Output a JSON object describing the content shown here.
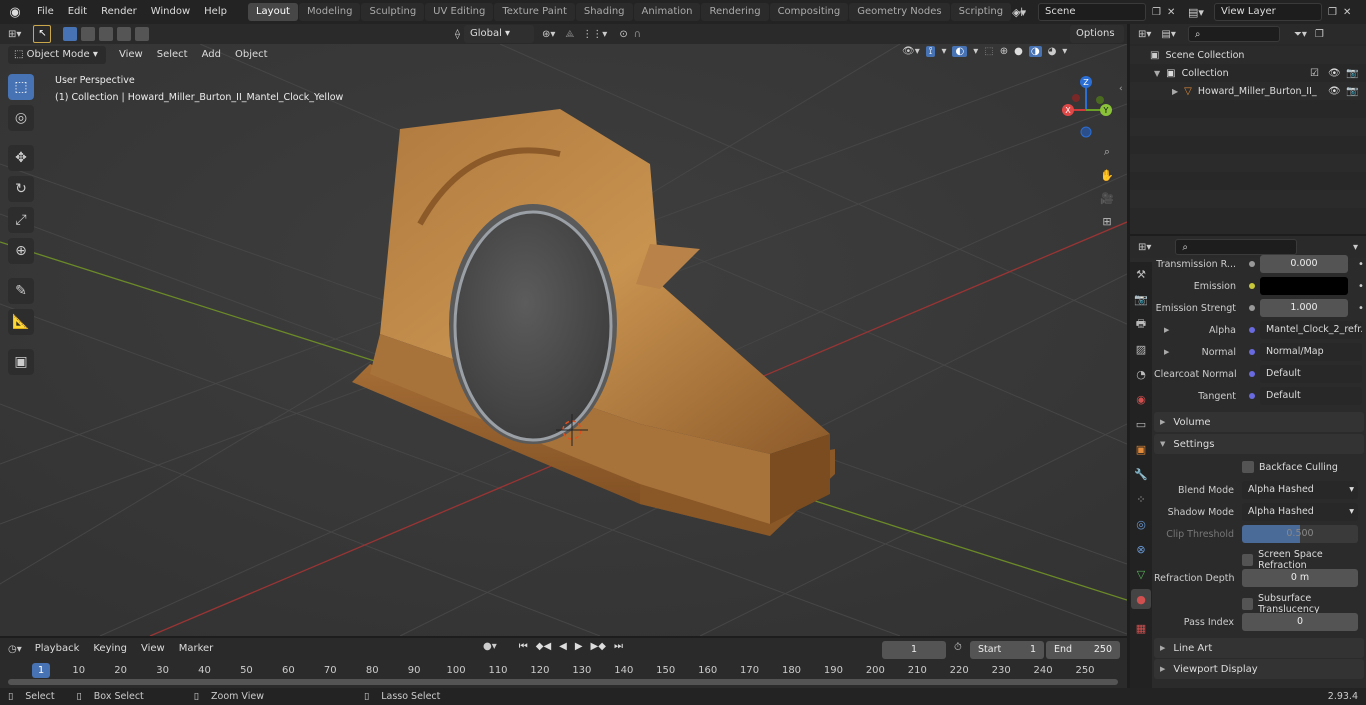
{
  "menu": [
    "File",
    "Edit",
    "Render",
    "Window",
    "Help"
  ],
  "workspaces": [
    "Layout",
    "Modeling",
    "Sculpting",
    "UV Editing",
    "Texture Paint",
    "Shading",
    "Animation",
    "Rendering",
    "Compositing",
    "Geometry Nodes",
    "Scripting"
  ],
  "scene": "Scene",
  "view_layer": "View Layer",
  "header": {
    "mode": "Object Mode",
    "menus": [
      "View",
      "Select",
      "Add",
      "Object"
    ],
    "transform": "Global",
    "options": "Options"
  },
  "viewport": {
    "perspective": "User Perspective",
    "collection_label": "(1) Collection | Howard_Miller_Burton_II_Mantel_Clock_Yellow",
    "gizmo": {
      "x": "X",
      "y": "Y",
      "z": "Z"
    }
  },
  "outliner": {
    "scene_collection": "Scene Collection",
    "collection": "Collection",
    "object": "Howard_Miller_Burton_II_"
  },
  "properties": {
    "rows": [
      {
        "label": "Transmission R...",
        "value": "0.000"
      },
      {
        "label": "Emission",
        "value": ""
      },
      {
        "label": "Emission Strengt",
        "value": "1.000"
      },
      {
        "label": "Alpha",
        "value": "Mantel_Clock_2_refr..."
      },
      {
        "label": "Normal",
        "value": "Normal/Map"
      },
      {
        "label": "Clearcoat Normal",
        "value": "Default"
      },
      {
        "label": "Tangent",
        "value": "Default"
      }
    ],
    "volume": "Volume",
    "settings": "Settings",
    "backface": "Backface Culling",
    "blend_label": "Blend Mode",
    "blend_value": "Alpha Hashed",
    "shadow_label": "Shadow Mode",
    "shadow_value": "Alpha Hashed",
    "clip_label": "Clip Threshold",
    "clip_value": "0.500",
    "ssr": "Screen Space Refraction",
    "refr_label": "Refraction Depth",
    "refr_value": "0 m",
    "sss": "Subsurface Translucency",
    "pass_label": "Pass Index",
    "pass_value": "0",
    "line_art": "Line Art",
    "viewport_display": "Viewport Display"
  },
  "timeline": {
    "menus": [
      "Playback",
      "Keying",
      "View",
      "Marker"
    ],
    "current": "1",
    "start_label": "Start",
    "start": "1",
    "end_label": "End",
    "end": "250",
    "ticks": [
      "1",
      "10",
      "20",
      "30",
      "40",
      "50",
      "60",
      "70",
      "80",
      "90",
      "100",
      "110",
      "120",
      "130",
      "140",
      "150",
      "160",
      "170",
      "180",
      "190",
      "200",
      "210",
      "220",
      "230",
      "240",
      "250"
    ]
  },
  "status": {
    "select": "Select",
    "box_select": "Box Select",
    "zoom_view": "Zoom View",
    "lasso_select": "Lasso Select",
    "version": "2.93.4"
  }
}
